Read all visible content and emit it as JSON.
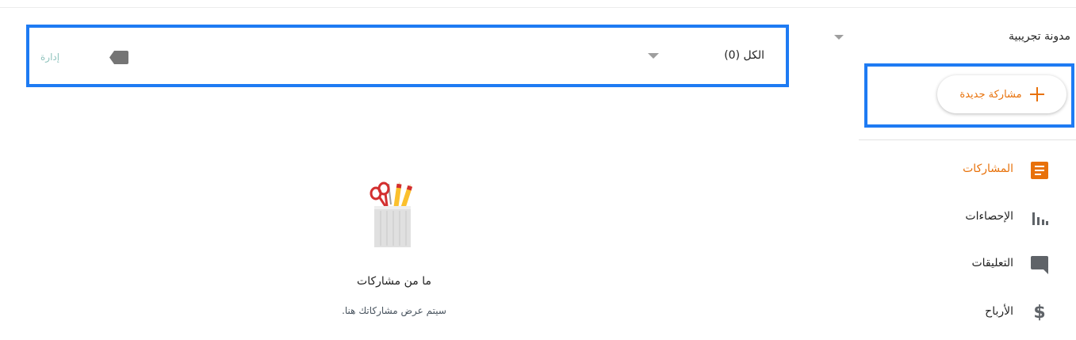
{
  "sidebar": {
    "blog_name": "مدونة تجريبية",
    "new_post_label": "مشاركة جديدة",
    "nav": [
      {
        "label": "المشاركات",
        "icon": "posts-icon",
        "active": true
      },
      {
        "label": "الإحصاءات",
        "icon": "stats-icon",
        "active": false
      },
      {
        "label": "التعليقات",
        "icon": "comments-icon",
        "active": false
      },
      {
        "label": "الأرباح",
        "icon": "dollar-icon",
        "active": false
      }
    ]
  },
  "toolbar": {
    "filter_label": "الكل (0)",
    "label_icon": "label-tag-icon",
    "manage_label": "إدارة"
  },
  "empty_state": {
    "title": "ما من مشاركات",
    "subtitle": "سيتم عرض مشاركاتك هنا.",
    "illustration": "pencil-cup-illustration"
  },
  "colors": {
    "accent": "#e8710a",
    "highlight": "#1e7bf3",
    "icon_gray": "#5f6368",
    "manage_link": "#8fc3bd"
  }
}
